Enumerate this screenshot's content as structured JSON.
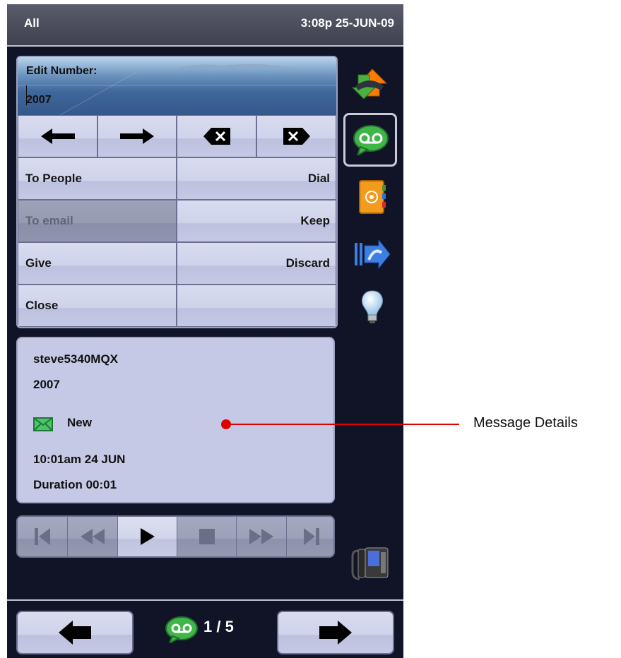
{
  "statusbar": {
    "filter": "All",
    "datetime": "3:08p 25-JUN-09"
  },
  "edit": {
    "label": "Edit Number:",
    "value": "2007"
  },
  "actions": {
    "to_people": "To People",
    "dial": "Dial",
    "to_email": "To email",
    "keep": "Keep",
    "give": "Give",
    "discard": "Discard",
    "close": "Close"
  },
  "message": {
    "sender": "steve5340MQX",
    "number": "2007",
    "status": "New",
    "received": "10:01am  24 JUN",
    "duration": "Duration 00:01"
  },
  "pager": {
    "text": "1 / 5"
  },
  "annotation": {
    "label": "Message Details",
    "color": "#e00000"
  },
  "icons": {
    "sidebar": [
      "call-transfer-icon",
      "voicemail-icon",
      "address-book-icon",
      "forward-call-icon",
      "lightbulb-icon",
      "desk-phone-icon"
    ],
    "edit_keys": [
      "arrow-left-icon",
      "arrow-right-icon",
      "backspace-icon",
      "delete-icon"
    ],
    "playback": [
      "skip-start-icon",
      "rewind-icon",
      "play-icon",
      "stop-icon",
      "fast-forward-icon",
      "skip-end-icon"
    ]
  },
  "colors": {
    "accent": "#c7cbe8",
    "background": "#111427",
    "new_envelope": "#2fa84f",
    "voicemail": "#2f9c3a"
  }
}
